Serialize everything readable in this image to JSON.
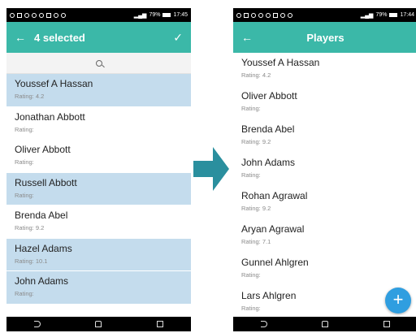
{
  "status": {
    "left_time": "17:45",
    "left_battery": "79%",
    "right_time": "17:44",
    "right_battery": "79%"
  },
  "left_screen": {
    "title": "4 selected",
    "back_icon": "back-arrow-icon",
    "confirm_icon": "check-icon",
    "search_icon": "search-icon",
    "items": [
      {
        "name": "Youssef A Hassan",
        "rating": "Rating: 4.2",
        "selected": true
      },
      {
        "name": "Jonathan Abbott",
        "rating": "Rating:",
        "selected": false
      },
      {
        "name": "Oliver Abbott",
        "rating": "Rating:",
        "selected": false
      },
      {
        "name": "Russell Abbott",
        "rating": "Rating:",
        "selected": true
      },
      {
        "name": "Brenda Abel",
        "rating": "Rating: 9.2",
        "selected": false
      },
      {
        "name": "Hazel Adams",
        "rating": "Rating: 10.1",
        "selected": true
      },
      {
        "name": "John Adams",
        "rating": "Rating:",
        "selected": true
      }
    ]
  },
  "right_screen": {
    "title": "Players",
    "back_icon": "back-arrow-icon",
    "fab_label": "+",
    "items": [
      {
        "name": "Youssef A Hassan",
        "rating": "Rating: 4.2"
      },
      {
        "name": "Oliver Abbott",
        "rating": "Rating:"
      },
      {
        "name": "Brenda Abel",
        "rating": "Rating: 9.2"
      },
      {
        "name": "John Adams",
        "rating": "Rating:"
      },
      {
        "name": "Rohan Agrawal",
        "rating": "Rating: 9.2"
      },
      {
        "name": "Aryan Agrawal",
        "rating": "Rating: 7.1"
      },
      {
        "name": "Gunnel Ahlgren",
        "rating": "Rating:"
      },
      {
        "name": "Lars Ahlgren",
        "rating": "Rating:"
      }
    ]
  },
  "colors": {
    "appbar": "#3bb8a8",
    "selected_row": "#c4dced",
    "fab": "#2f9ee0",
    "arrow": "#2a8f9e"
  }
}
